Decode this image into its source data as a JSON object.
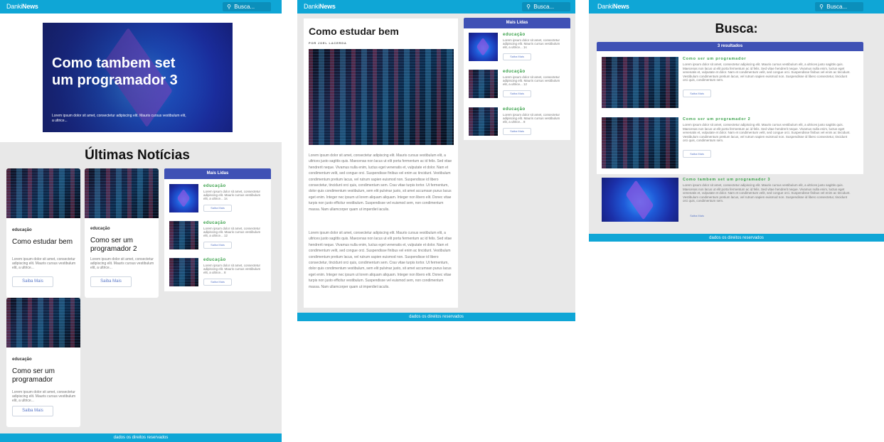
{
  "brand": {
    "thin": "Danki",
    "bold": "News"
  },
  "search": {
    "placeholder": "Busca..."
  },
  "footer": "dados os direitos reservados",
  "colors": {
    "topbar": "#0fa6d6",
    "accent": "#3f51b5",
    "category": "#3aa04a"
  },
  "home": {
    "hero": {
      "title": "Como tambem set um programador 3",
      "desc": "Lorem ipsum dolor sit amet, consectetur adipiscing elit. Mauris cursus vestibulum elit, a ultrice..."
    },
    "section_title": "Últimas Notícias",
    "cards": [
      {
        "category": "educação",
        "title": "Como estudar bem",
        "desc": "Lorem ipsum dolor sit amet, consectetur adipiscing elit. Mauris cursus vestibulum elit, a ultrice...",
        "button": "Saiba Mais"
      },
      {
        "category": "educação",
        "title": "Como ser um programador 2",
        "desc": "Lorem ipsum dolor sit amet, consectetur adipiscing elit. Mauris cursus vestibulum elit, a ultrice...",
        "button": "Saiba Mais"
      },
      {
        "category": "educação",
        "title": "Como ser um programador",
        "desc": "Lorem ipsum dolor sit amet, consectetur adipiscing elit. Mauris cursus vestibulum elit, a ultrice...",
        "button": "Saiba Mais"
      }
    ]
  },
  "mais_lidas": {
    "title": "Mais Lidas",
    "items": [
      {
        "category": "educação",
        "desc": "Lorem ipsum dolor sit amet, consectetur adipiscing elit. Mauris cursus vestibulum elit, a ultrice... 1s",
        "button": "Saiba Mais"
      },
      {
        "category": "educação",
        "desc": "Lorem ipsum dolor sit amet, consectetur adipiscing elit. Mauris cursus vestibulum elit, a ultrice... 12",
        "button": "Saiba Mais"
      },
      {
        "category": "educação",
        "desc": "Lorem ipsum dolor sit amet, consectetur adipiscing elit. Mauris cursus vestibulum elit, a ultrice... 8",
        "button": "Saiba Mais"
      }
    ]
  },
  "article": {
    "title": "Como estudar bem",
    "author": "POR JOEL LACERDA",
    "p1": "Lorem ipsum dolor sit amet, consectetur adipiscing elit. Mauris cursus vestibulum elit, a ultrices justo sagittis quis. Maecenas non lacus ut elit porta fermentum ac id felis. Sed vitae hendrerit neque. Vivamus nulla enim, luctus eget venenatis et, vulputate et dolor. Nam et condimentum velit, sed congue orci. Suspendisse finibus vel enim ac tincidunt. Vestibulum condimentum pretium lacus, vel rutrum sapien euismod non. Suspendisse id libero consectetur, tincidunt orci quis, condimentum sem. Cras vitae turpis tortor. Ut fermentum, dolor quis condimentum vestibulum, sem elit pulvinar justo, sit amet accumsan purus lacus eget enim. Integer nec ipsum ut lorem aliquam aliquam. Integer non libero elit. Donec vitae turpis non justo efficitur vestibulum. Suspendisse vel euismod sem, non condimentum massa. Nam ullamcorper quam ut imperdiet iaculis.",
    "p2": "Lorem ipsum dolor sit amet, consectetur adipiscing elit. Mauris cursus vestibulum elit, a ultrices justo sagittis quis. Maecenas non lacus ut elit porta fermentum ac id felis. Sed vitae hendrerit neque. Vivamus nulla enim, luctus eget venenatis et, vulputate et dolor. Nam et condimentum velit, sed congue orci. Suspendisse finibus vel enim ac tincidunt. Vestibulum condimentum pretium lacus, vel rutrum sapien euismod non. Suspendisse id libero consectetur, tincidunt orci quis, condimentum sem. Cras vitae turpis tortor. Ut fermentum, dolor quis condimentum vestibulum, sem elit pulvinar justo, sit amet accumsan purus lacus eget enim. Integer nec ipsum ut lorem aliquam aliquam. Integer non libero elit. Donec vitae turpis non justo efficitur vestibulum. Suspendisse vel euismod sem, non condimentum massa. Nam ullamcorper quam ut imperdiet iaculis."
  },
  "busca": {
    "title": "Busca:",
    "count": "3 resultados",
    "results": [
      {
        "title": "Como ser um programador",
        "desc": "Lorem ipsum dolor sit amet, consectetur adipiscing elit. Mauris cursus vestibulum elit, a ultrices justo sagittis quis. Maecenas non lacus ut elit porta fermentum ac id felis. Sed vitae hendrerit neque. Vivamus nulla enim, luctus eget venenatis et, vulputate et dolor. Nam et condimentum velit, sed congue orci. Suspendisse finibus vel enim ac tincidunt. Vestibulum condimentum pretium lacus, vel rutrum sapien euismod non. Suspendisse id libero consectetur, tincidunt orci quis, condimentum sem.",
        "button": "Saiba Mais"
      },
      {
        "title": "Como ser um programador 2",
        "desc": "Lorem ipsum dolor sit amet, consectetur adipiscing elit. Mauris cursus vestibulum elit, a ultrices justo sagittis quis. Maecenas non lacus ut elit porta fermentum ac id felis. Sed vitae hendrerit neque. Vivamus nulla enim, luctus eget venenatis et, vulputate et dolor. Nam et condimentum velit, sed congue orci. Suspendisse finibus vel enim ac tincidunt. Vestibulum condimentum pretium lacus, vel rutrum sapien euismod non. Suspendisse id libero consectetur, tincidunt orci quis, condimentum sem.",
        "button": "Saiba Mais"
      },
      {
        "title": "Como tambem set um programador 3",
        "desc": "Lorem ipsum dolor sit amet, consectetur adipiscing elit. Mauris cursus vestibulum elit, a ultrices justo sagittis quis. Maecenas non lacus ut elit porta fermentum ac id felis. Sed vitae hendrerit neque. Vivamus nulla enim, luctus eget venenatis et, vulputate et dolor. Nam et condimentum velit, sed congue orci. Suspendisse finibus vel enim ac tincidunt. Vestibulum condimentum pretium lacus, vel rutrum sapien euismod non. Suspendisse id libero consectetur, tincidunt orci quis, condimentum sem.",
        "button": "Saiba Mais"
      }
    ]
  }
}
